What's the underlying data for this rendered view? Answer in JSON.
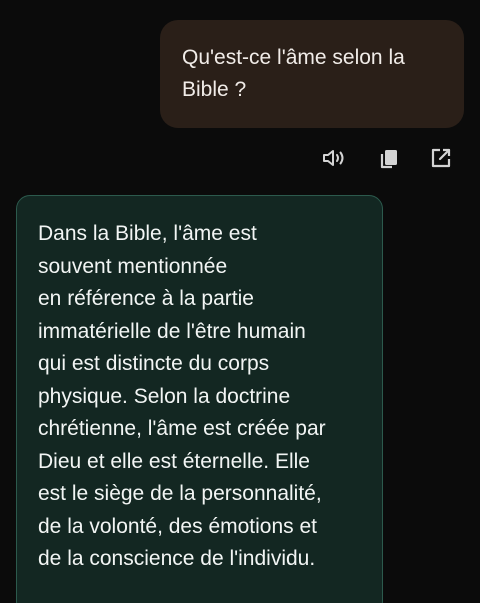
{
  "conversation": {
    "user_message": {
      "lines": [
        "Qu'est-ce l'âme selon la",
        "Bible ?"
      ]
    },
    "message_actions": [
      {
        "icon": "speaker-icon",
        "label": ""
      },
      {
        "icon": "copy-icon",
        "label": ""
      },
      {
        "icon": "share-external-icon",
        "label": ""
      }
    ],
    "bot_message": {
      "lines": [
        "Dans la Bible, l'âme est",
        "souvent mentionnée",
        "en référence à la partie",
        "immatérielle de l'être humain",
        "qui est distincte du corps",
        "physique. Selon la doctrine",
        "chrétienne, l'âme est créée par",
        "Dieu et elle est éternelle. Elle",
        "est le siège de la personnalité,",
        "de la volonté, des émotions et",
        "de la conscience de l'individu."
      ]
    }
  },
  "colors": {
    "background": "#0b0b0b",
    "user_bubble": "#2a1f18",
    "bot_bubble": "#132722",
    "bot_border": "#2c5a4d",
    "icon": "#d4d4d4"
  }
}
